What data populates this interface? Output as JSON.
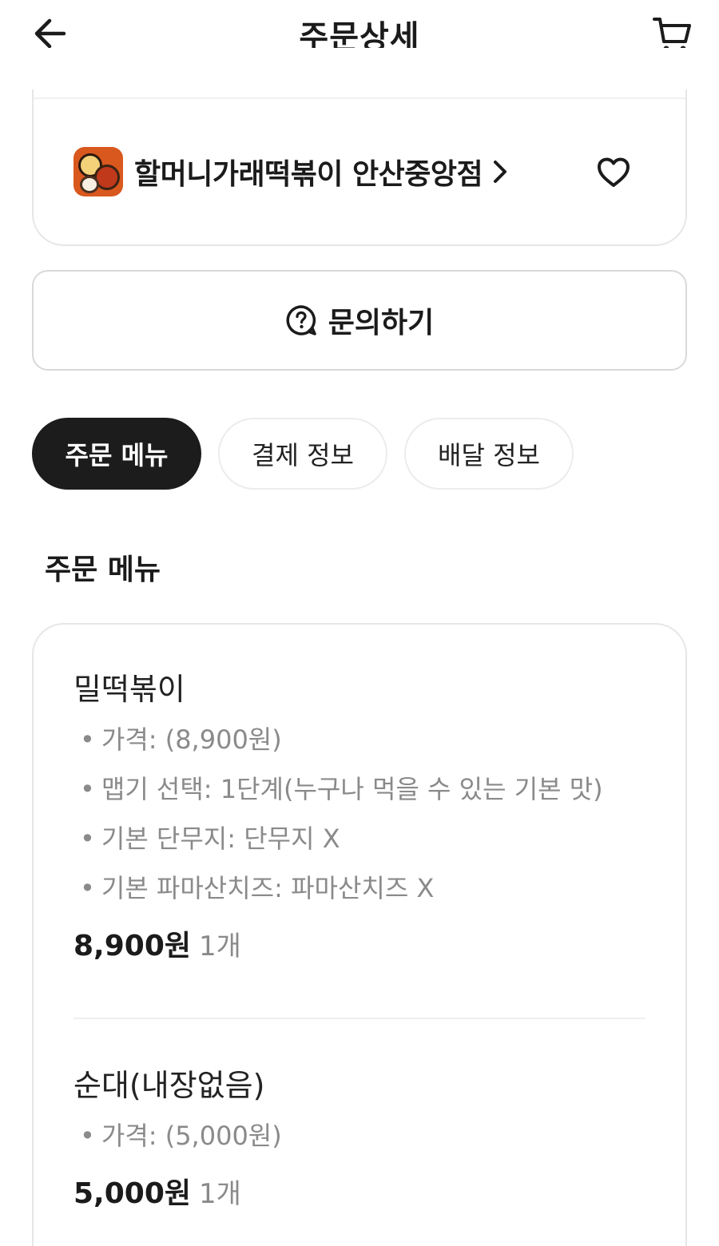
{
  "header": {
    "title": "주문상세",
    "back_icon": "arrow-left-icon",
    "cart_icon": "cart-icon"
  },
  "store": {
    "name": "할머니가래떡볶이 안산중앙점",
    "chevron": "›",
    "logo_icon": "store-logo",
    "favorite_icon": "heart-outline-icon"
  },
  "inquiry": {
    "label": "문의하기",
    "icon": "question-bubble-icon"
  },
  "tabs": [
    {
      "label": "주문 메뉴",
      "active": true
    },
    {
      "label": "결제 정보",
      "active": false
    },
    {
      "label": "배달 정보",
      "active": false
    }
  ],
  "section": {
    "title": "주문 메뉴"
  },
  "items": [
    {
      "name": "밀떡볶이",
      "options": [
        "가격:  (8,900원)",
        "맵기 선택: 1단계(누구나 먹을 수 있는 기본 맛)",
        "기본 단무지: 단무지 X",
        "기본 파마산치즈: 파마산치즈 X"
      ],
      "price": "8,900원",
      "quantity": "1개"
    },
    {
      "name": "순대(내장없음)",
      "options": [
        "가격:  (5,000원)"
      ],
      "price": "5,000원",
      "quantity": "1개"
    }
  ],
  "bullet": "•"
}
